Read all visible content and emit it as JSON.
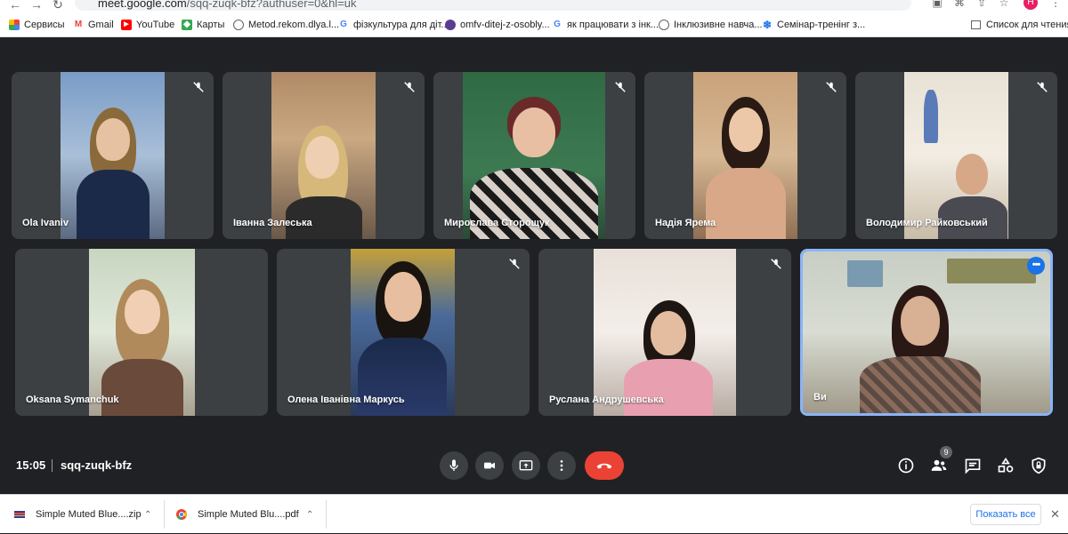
{
  "browser": {
    "url_host": "meet.google.com",
    "url_path": "/sqq-zuqk-bfz?authuser=0&hl=uk",
    "profile_initial": "Н",
    "bookmarks": [
      {
        "label": "Сервисы",
        "icon": "apps-grid-icon"
      },
      {
        "label": "Gmail",
        "icon": "gmail-icon"
      },
      {
        "label": "YouTube",
        "icon": "youtube-icon"
      },
      {
        "label": "Карты",
        "icon": "maps-icon"
      },
      {
        "label": "Metod.rekom.dlya.l...",
        "icon": "globe-icon"
      },
      {
        "label": "фізкультура для діт...",
        "icon": "google-icon"
      },
      {
        "label": "omfv-ditej-z-osobly...",
        "icon": "site-icon"
      },
      {
        "label": "як працювати з інк...",
        "icon": "google-icon"
      },
      {
        "label": "Інклюзивне навча...",
        "icon": "globe-icon"
      },
      {
        "label": "Семінар-тренінг з...",
        "icon": "snowflake-icon"
      }
    ],
    "reading_list": "Список для чтения"
  },
  "participants": [
    {
      "name": "Ola Ivaniv",
      "muted": true
    },
    {
      "name": "Іванна Залеська",
      "muted": true
    },
    {
      "name": "Мирослава Сторощук",
      "muted": true
    },
    {
      "name": "Надія Ярема",
      "muted": true
    },
    {
      "name": "Володимир Райковський",
      "muted": true
    },
    {
      "name": "Oksana Symanchuk",
      "muted": false
    },
    {
      "name": "Олена Іванівна Маркусь",
      "muted": true
    },
    {
      "name": "Руслана Андрушевська",
      "muted": true
    },
    {
      "name": "Ви",
      "muted": false,
      "self": true
    }
  ],
  "meeting": {
    "time": "15:05",
    "code": "sqq-zuqk-bfz",
    "participant_count": "9"
  },
  "downloads": {
    "items": [
      {
        "name": "Simple Muted Blue....zip"
      },
      {
        "name": "Simple Muted Blu....pdf"
      }
    ],
    "show_all": "Показать все"
  }
}
